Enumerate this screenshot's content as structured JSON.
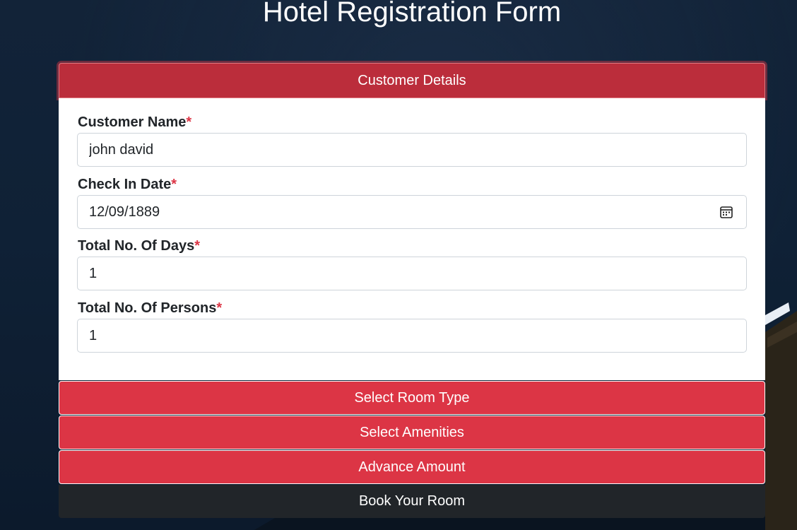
{
  "page": {
    "title": "Hotel Registration Form"
  },
  "sections": {
    "customer_details": "Customer Details",
    "room_type": "Select Room Type",
    "amenities": "Select Amenities",
    "advance_amount": "Advance Amount"
  },
  "form": {
    "required_marker": "*",
    "customer_name": {
      "label": "Customer Name",
      "value": "john david"
    },
    "check_in_date": {
      "label": "Check In Date",
      "value": "12/09/1889"
    },
    "total_days": {
      "label": "Total No. Of Days",
      "value": "1"
    },
    "total_persons": {
      "label": "Total No. Of Persons",
      "value": "1"
    }
  },
  "submit": {
    "label": "Book Your Room"
  },
  "icons": {
    "date_picker": "calendar-icon"
  },
  "colors": {
    "accent": "#dc3545",
    "accent_active": "#bb2d3b",
    "submit_bg": "#212529",
    "background": "#0f2136"
  }
}
